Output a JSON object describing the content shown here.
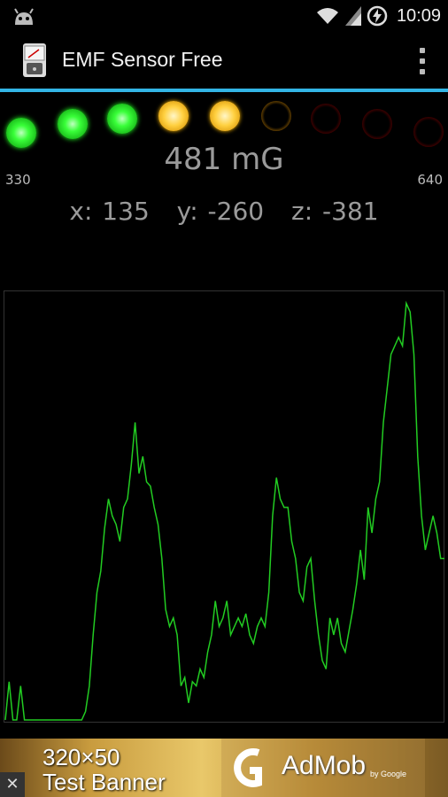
{
  "status_bar": {
    "time": "10:09",
    "icons": [
      "android-head-icon",
      "wifi-icon",
      "signal-icon",
      "battery-charging-icon"
    ]
  },
  "action_bar": {
    "title": "EMF Sensor Free",
    "icon": "emf-meter-icon",
    "menu_icon": "overflow-menu-icon"
  },
  "colors": {
    "accent": "#33b5e5",
    "graph_line": "#22cc22",
    "led_green": "#39ff39",
    "led_yellow": "#ffd040",
    "led_red_off": "#8a1010"
  },
  "meter": {
    "leds": [
      {
        "color": "green",
        "state": "on"
      },
      {
        "color": "green",
        "state": "on"
      },
      {
        "color": "green",
        "state": "on"
      },
      {
        "color": "yellow",
        "state": "on"
      },
      {
        "color": "yellow",
        "state": "on"
      },
      {
        "color": "yellow",
        "state": "off"
      },
      {
        "color": "red",
        "state": "off"
      },
      {
        "color": "red",
        "state": "off"
      },
      {
        "color": "red",
        "state": "off"
      }
    ],
    "min_label": "330",
    "max_label": "640",
    "reading": "481 mG",
    "x": "x: 135",
    "y": "y: -260",
    "z": "z: -381"
  },
  "chart_data": {
    "type": "line",
    "grid": false,
    "ylim": [
      0,
      100
    ],
    "series": [
      {
        "values": [
          0,
          9,
          0,
          0,
          8,
          0,
          0,
          0,
          0,
          0,
          0,
          0,
          0,
          0,
          0,
          0,
          0,
          0,
          0,
          0,
          0,
          2,
          8,
          20,
          30,
          35,
          45,
          52,
          48,
          46,
          42,
          50,
          52,
          60,
          70,
          58,
          62,
          56,
          55,
          50,
          46,
          38,
          26,
          22,
          24,
          20,
          8,
          10,
          4,
          9,
          8,
          12,
          10,
          16,
          20,
          28,
          22,
          24,
          28,
          20,
          22,
          24,
          22,
          25,
          20,
          18,
          22,
          24,
          22,
          30,
          48,
          57,
          52,
          50,
          50,
          42,
          38,
          30,
          28,
          36,
          38,
          28,
          20,
          14,
          12,
          24,
          20,
          24,
          18,
          16,
          21,
          26,
          32,
          40,
          33,
          50,
          44,
          52,
          56,
          70,
          78,
          86,
          88,
          90,
          88,
          98,
          96,
          86,
          62,
          48,
          40,
          44,
          48,
          44,
          38,
          38
        ]
      }
    ]
  },
  "ad": {
    "line1": "320×50",
    "line2": "Test Banner",
    "brand": "AdMob",
    "by": "by Google",
    "close": "✕"
  }
}
